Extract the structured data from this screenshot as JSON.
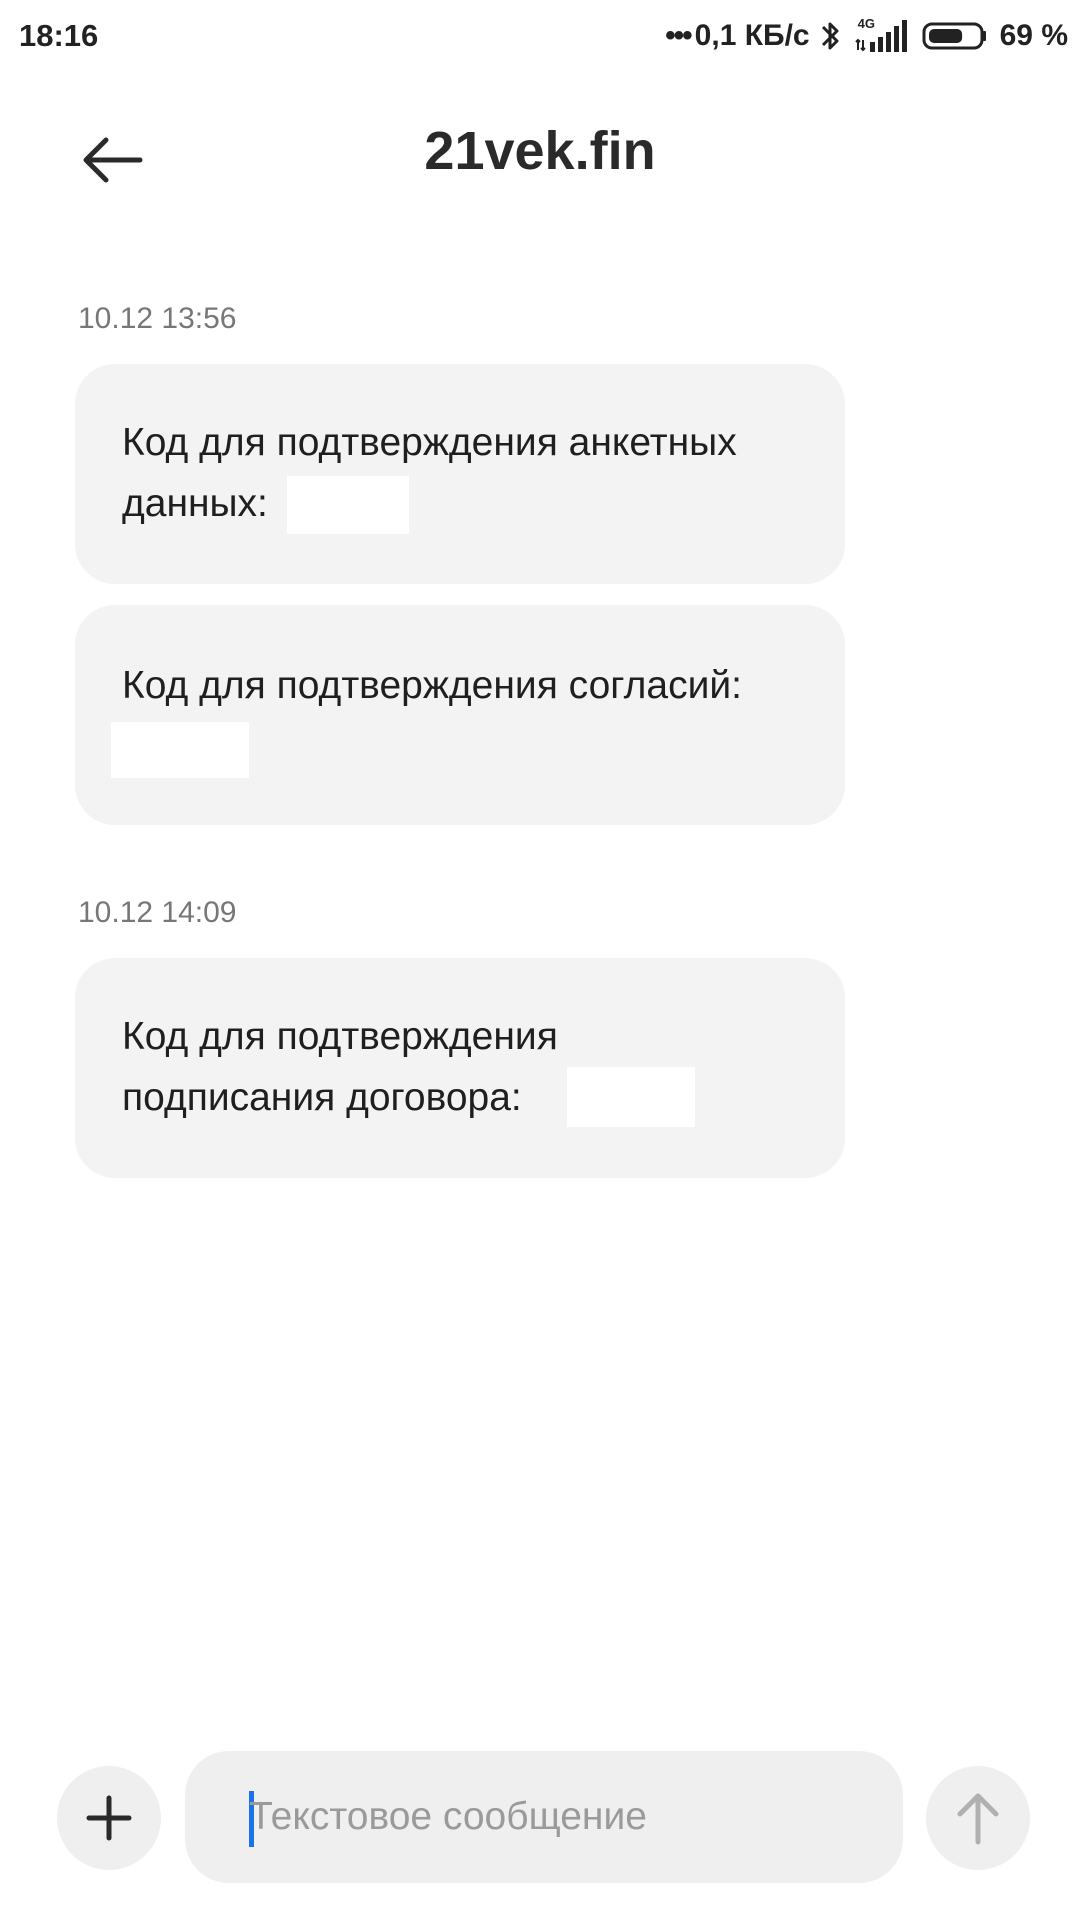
{
  "status_bar": {
    "time": "18:16",
    "dots": "•••",
    "net_speed": "0,1 КБ/с",
    "network": "4G",
    "battery_level": 0.69,
    "battery_pct": "69 %"
  },
  "header": {
    "back_icon": "arrow-left-icon",
    "title": "21vek.fin"
  },
  "messages": [
    {
      "timestamp": "10.12 13:56",
      "bubbles": [
        {
          "line1": "Код для подтверждения анкетных",
          "line2": "данных:"
        },
        {
          "line1": "Код для подтверждения согласий:"
        }
      ]
    },
    {
      "timestamp": "10.12 14:09",
      "bubbles": [
        {
          "line1": "Код для подтверждения",
          "line2": "подписания договора:"
        }
      ]
    }
  ],
  "composer": {
    "attach_icon": "plus-icon",
    "placeholder": "Текстовое сообщение",
    "send_icon": "arrow-up-icon"
  },
  "colors": {
    "bubble": "#f3f3f3",
    "caret": "#1a73e8",
    "placeholder": "#9a9a9a"
  }
}
